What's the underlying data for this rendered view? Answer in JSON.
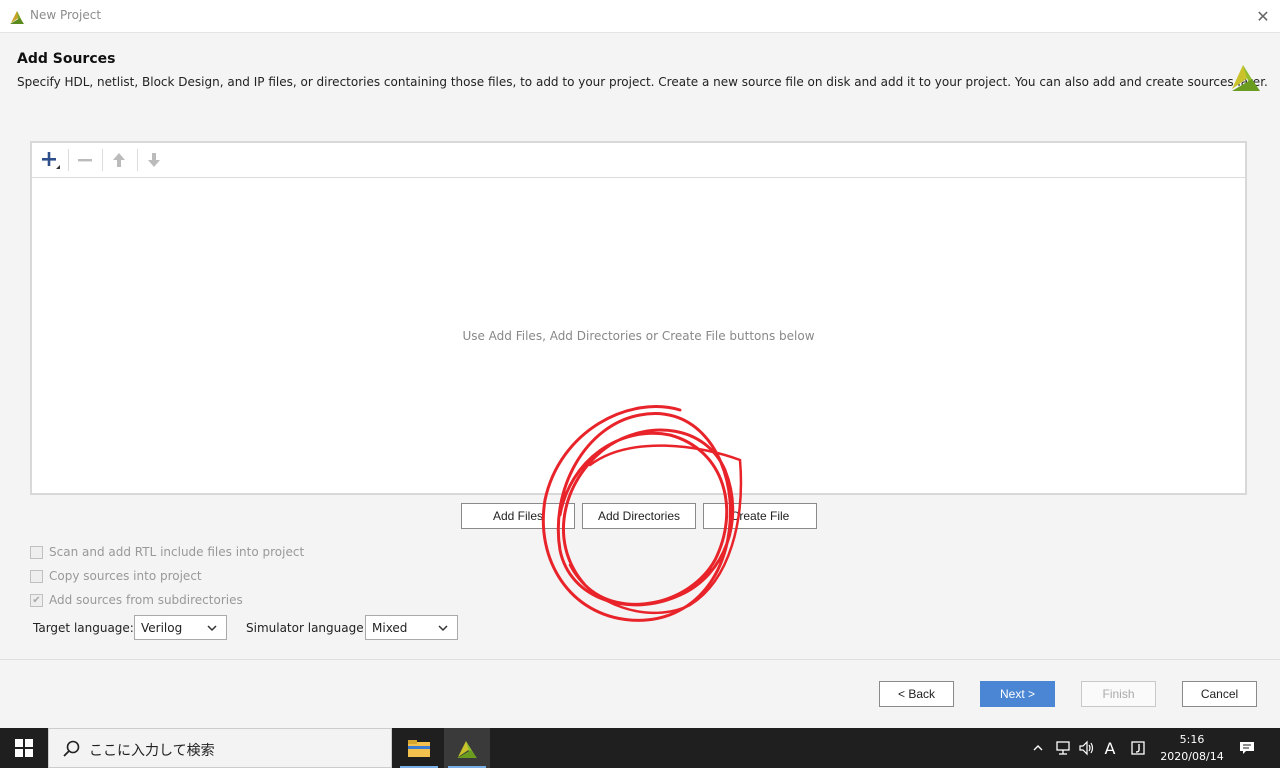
{
  "window": {
    "title": "New Project",
    "close_label": "✕"
  },
  "header": {
    "title": "Add Sources",
    "description": "Specify HDL, netlist, Block Design, and IP files, or directories containing those files, to add to your project. Create a new source file on disk and add it to your project. You can also add and create sources later."
  },
  "sources_panel": {
    "empty_message": "Use Add Files, Add Directories or Create File buttons below",
    "toolbar": {
      "add_icon": "plus-icon",
      "remove_icon": "minus-icon",
      "up_icon": "arrow-up-icon",
      "down_icon": "arrow-down-icon"
    }
  },
  "actions": {
    "add_files": "Add Files",
    "add_directories": "Add Directories",
    "create_file": "Create File"
  },
  "options": {
    "scan_rtl": "Scan and add RTL include files into project",
    "copy_sources": "Copy sources into project",
    "add_subdirs": "Add sources from subdirectories"
  },
  "language": {
    "target_label": "Target language:",
    "target_value": "Verilog",
    "simulator_label": "Simulator language:",
    "simulator_value": "Mixed"
  },
  "footer": {
    "back": "< Back",
    "next": "Next >",
    "finish": "Finish",
    "cancel": "Cancel"
  },
  "taskbar": {
    "search_placeholder": "ここに入力して検索",
    "time": "5:16",
    "date": "2020/08/14",
    "ime": "A"
  },
  "colors": {
    "accent": "#4a86d4",
    "annotation": "#e8242a",
    "vivado_green": "#7da82b"
  }
}
